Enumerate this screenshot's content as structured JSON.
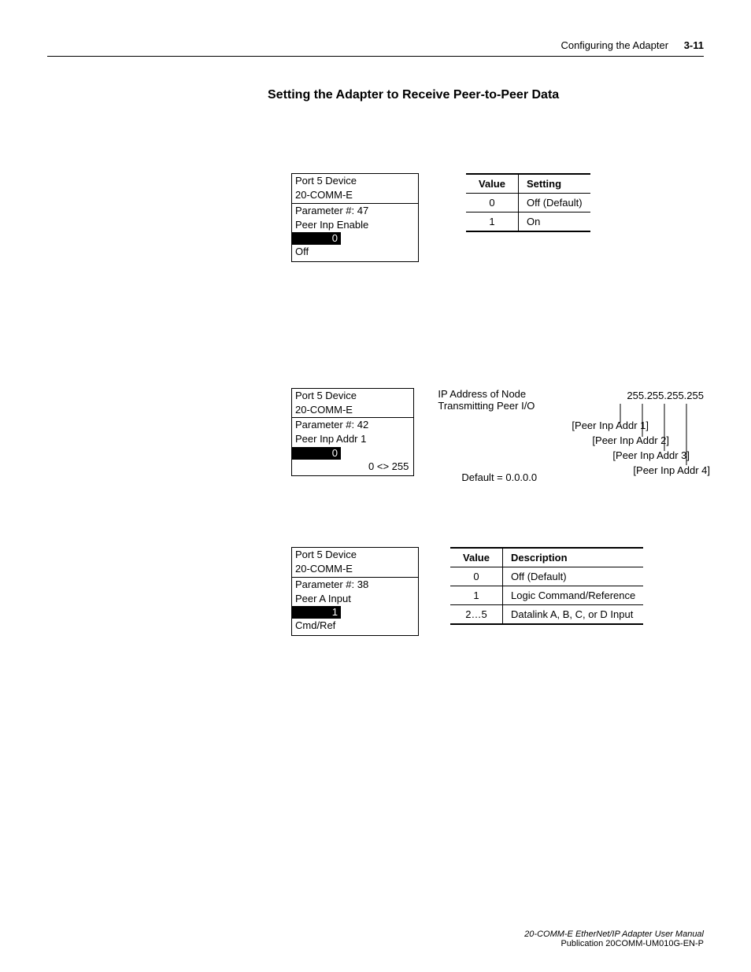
{
  "header": {
    "running_head": "Configuring the Adapter",
    "page_number": "3-11"
  },
  "section_title": "Setting the Adapter to Receive Peer-to-Peer Data",
  "block1": {
    "lcd": {
      "port": "Port 5 Device",
      "device": "20-COMM-E",
      "param_line": "Parameter #: 47",
      "param_name": "Peer Inp Enable",
      "value_highlight": "0",
      "status_text": "Off"
    },
    "table": {
      "head_value": "Value",
      "head_setting": "Setting",
      "rows": [
        {
          "value": "0",
          "setting": "Off (Default)"
        },
        {
          "value": "1",
          "setting": "On"
        }
      ]
    }
  },
  "block2": {
    "lcd": {
      "port": "Port 5 Device",
      "device": "20-COMM-E",
      "param_line": "Parameter #: 42",
      "param_name": "Peer Inp Addr 1",
      "value_highlight": "0",
      "range_text": "0 <> 255"
    },
    "diagram": {
      "node_label_line1": "IP Address of Node",
      "node_label_line2": "Transmitting Peer I/O",
      "ip_value": "255.255.255.255",
      "addr1": "[Peer Inp Addr 1]",
      "addr2": "[Peer Inp Addr 2]",
      "addr3": "[Peer Inp Addr 3]",
      "addr4": "[Peer Inp Addr 4]",
      "default_label": "Default = 0.0.0.0"
    }
  },
  "block3": {
    "lcd": {
      "port": "Port 5 Device",
      "device": "20-COMM-E",
      "param_line": "Parameter #: 38",
      "param_name": "Peer A Input",
      "value_highlight": "1",
      "status_text": "Cmd/Ref"
    },
    "table": {
      "head_value": "Value",
      "head_desc": "Description",
      "rows": [
        {
          "value": "0",
          "desc": "Off (Default)"
        },
        {
          "value": "1",
          "desc": "Logic Command/Reference"
        },
        {
          "value": "2…5",
          "desc": "Datalink A, B, C, or D Input"
        }
      ]
    }
  },
  "footer": {
    "manual_title": "20-COMM-E EtherNet/IP Adapter User Manual",
    "publication": "Publication 20COMM-UM010G-EN-P"
  }
}
